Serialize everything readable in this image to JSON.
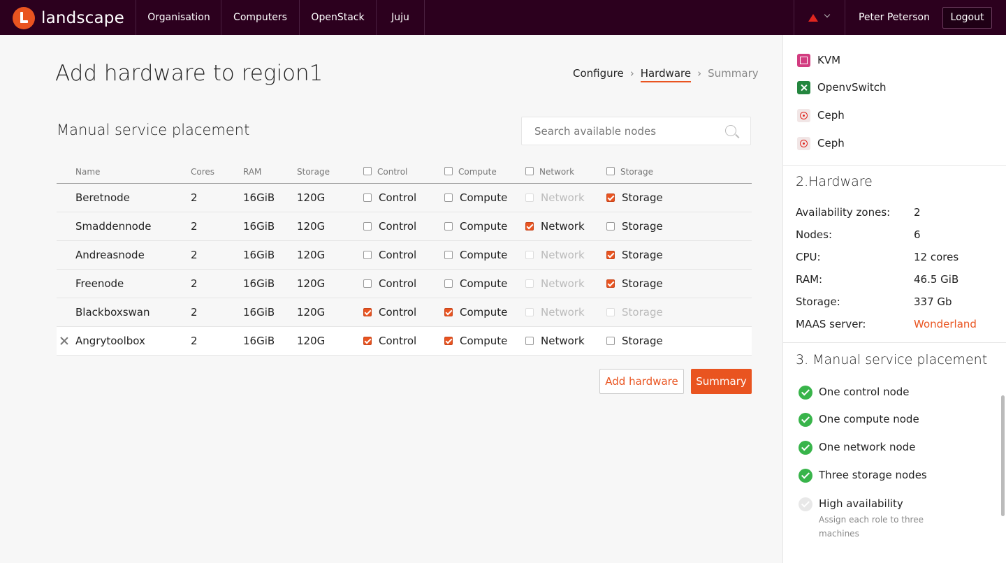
{
  "nav": {
    "brand": "landscape",
    "links": [
      "Organisation",
      "Computers",
      "OpenStack",
      "Juju"
    ],
    "user": "Peter Peterson",
    "logout": "Logout",
    "brand_color": "#e95420",
    "bg_color": "#2c001e",
    "alert_icon": "warning-triangle-icon"
  },
  "page": {
    "title": "Add hardware to region1",
    "breadcrumb": [
      "Configure",
      "Hardware",
      "Summary"
    ],
    "section_title": "Manual service placement",
    "search_placeholder": "Search available nodes"
  },
  "table": {
    "headers": {
      "name": "Name",
      "cores": "Cores",
      "ram": "RAM",
      "storage": "Storage",
      "control": "Control",
      "compute": "Compute",
      "network": "Network",
      "storage_role": "Storage"
    },
    "rows": [
      {
        "name": "Beretnode",
        "cores": "2",
        "ram": "16GiB",
        "storage": "120G",
        "control": "Control",
        "compute": "Compute",
        "network": "Network",
        "storage_role": "Storage",
        "state": {
          "control": "off",
          "compute": "off",
          "network": "disabled",
          "storage": "on"
        },
        "selected": false
      },
      {
        "name": "Smaddennode",
        "cores": "2",
        "ram": "16GiB",
        "storage": "120G",
        "control": "Control",
        "compute": "Compute",
        "network": "Network",
        "storage_role": "Storage",
        "state": {
          "control": "off",
          "compute": "off",
          "network": "on",
          "storage": "off"
        },
        "selected": false
      },
      {
        "name": "Andreasnode",
        "cores": "2",
        "ram": "16GiB",
        "storage": "120G",
        "control": "Control",
        "compute": "Compute",
        "network": "Network",
        "storage_role": "Storage",
        "state": {
          "control": "off",
          "compute": "off",
          "network": "disabled",
          "storage": "on"
        },
        "selected": false
      },
      {
        "name": "Freenode",
        "cores": "2",
        "ram": "16GiB",
        "storage": "120G",
        "control": "Control",
        "compute": "Compute",
        "network": "Network",
        "storage_role": "Storage",
        "state": {
          "control": "off",
          "compute": "off",
          "network": "disabled",
          "storage": "on"
        },
        "selected": false
      },
      {
        "name": "Blackboxswan",
        "cores": "2",
        "ram": "16GiB",
        "storage": "120G",
        "control": "Control",
        "compute": "Compute",
        "network": "Network",
        "storage_role": "Storage",
        "state": {
          "control": "on",
          "compute": "on",
          "network": "disabled",
          "storage": "disabled"
        },
        "selected": false
      },
      {
        "name": "Angrytoolbox",
        "cores": "2",
        "ram": "16GiB",
        "storage": "120G",
        "control": "Control",
        "compute": "Compute",
        "network": "Network",
        "storage_role": "Storage",
        "state": {
          "control": "on",
          "compute": "on",
          "network": "off",
          "storage": "off"
        },
        "selected": true
      }
    ]
  },
  "actions": {
    "add_hardware": "Add hardware",
    "summary": "Summary"
  },
  "sidebar": {
    "services": [
      {
        "label": "KVM",
        "icon": "kvm-icon"
      },
      {
        "label": "OpenvSwitch",
        "icon": "openvswitch-icon"
      },
      {
        "label": "Ceph",
        "icon": "ceph-icon"
      },
      {
        "label": "Ceph",
        "icon": "ceph-icon"
      }
    ],
    "hardware_title": "2.Hardware",
    "hardware": [
      {
        "key": "Availability zones:",
        "value": "2"
      },
      {
        "key": "Nodes:",
        "value": "6"
      },
      {
        "key": "CPU:",
        "value": "12 cores"
      },
      {
        "key": "RAM:",
        "value": "46.5 GiB"
      },
      {
        "key": "Storage:",
        "value": "337 Gb"
      },
      {
        "key": "MAAS server:",
        "value": "Wonderland"
      }
    ],
    "placement_title": "3. Manual service placement",
    "checklist": [
      {
        "label": "One control node",
        "done": true
      },
      {
        "label": "One compute node",
        "done": true
      },
      {
        "label": "One network node",
        "done": true
      },
      {
        "label": "Three storage nodes",
        "done": true
      },
      {
        "label": "High availability",
        "done": false,
        "hint": "Assign each role to three machines"
      }
    ]
  }
}
